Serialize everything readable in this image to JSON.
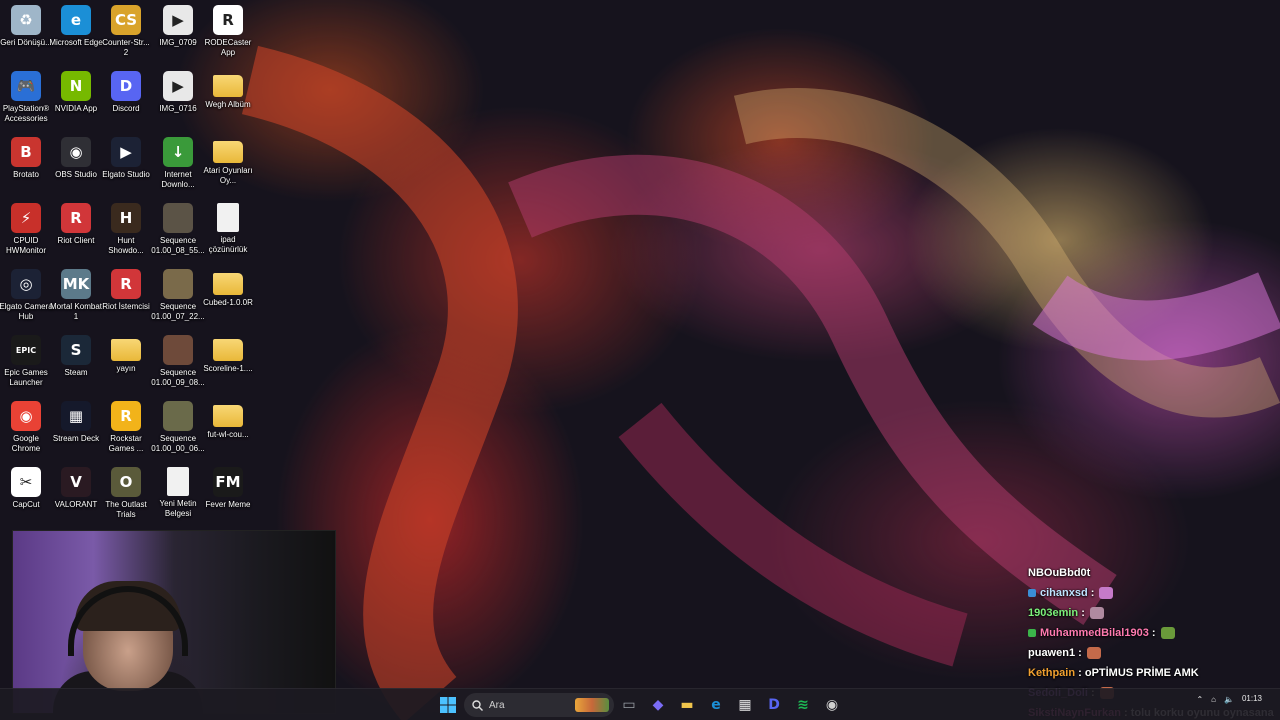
{
  "desktop_icons": [
    {
      "label": "Geri Dönüşü...",
      "icon": "recycle-bin-icon",
      "color": "#9fb6c9",
      "glyph": "♻"
    },
    {
      "label": "Microsoft Edge",
      "icon": "edge-icon",
      "color": "#1b8fd6",
      "glyph": "e"
    },
    {
      "label": "Counter-Str... 2",
      "icon": "counter-strike-icon",
      "color": "#d9a32b",
      "glyph": "CS"
    },
    {
      "label": "IMG_0709",
      "icon": "video-file-icon",
      "color": "#e8e8e8",
      "glyph": "▶"
    },
    {
      "label": "RODECaster App",
      "icon": "rodecaster-icon",
      "color": "#ffffff",
      "glyph": "R"
    },
    {
      "label": "PlayStation® Accessories",
      "icon": "playstation-icon",
      "color": "#2a6fd6",
      "glyph": "🎮"
    },
    {
      "label": "NVIDIA App",
      "icon": "nvidia-icon",
      "color": "#76b900",
      "glyph": "N"
    },
    {
      "label": "Discord",
      "icon": "discord-icon",
      "color": "#5865f2",
      "glyph": "D"
    },
    {
      "label": "IMG_0716",
      "icon": "video-file-icon",
      "color": "#e8e8e8",
      "glyph": "▶"
    },
    {
      "label": "Wegh Albüm",
      "icon": "folder-icon",
      "color": "#f0c44c",
      "glyph": ""
    },
    {
      "label": "Brotato",
      "icon": "brotato-icon",
      "color": "#c9352f",
      "glyph": "B"
    },
    {
      "label": "OBS Studio",
      "icon": "obs-icon",
      "color": "#2f2f35",
      "glyph": "◉"
    },
    {
      "label": "Elgato Studio",
      "icon": "elgato-studio-icon",
      "color": "#1c2235",
      "glyph": "▶"
    },
    {
      "label": "Internet Downlo...",
      "icon": "internet-download-icon",
      "color": "#3a9a3a",
      "glyph": "↓"
    },
    {
      "label": "Atari Oyunları Oy...",
      "icon": "folder-icon",
      "color": "#f0c44c",
      "glyph": ""
    },
    {
      "label": "CPUID HWMonitor",
      "icon": "hwmonitor-icon",
      "color": "#c8302a",
      "glyph": "⚡"
    },
    {
      "label": "Riot Client",
      "icon": "riot-client-icon",
      "color": "#d13639",
      "glyph": "R"
    },
    {
      "label": "Hunt Showdo...",
      "icon": "hunt-showdown-icon",
      "color": "#3a2a1e",
      "glyph": "H"
    },
    {
      "label": "Sequence 01.00_08_55...",
      "icon": "image-thumbnail-icon",
      "color": "#5b5346",
      "glyph": ""
    },
    {
      "label": "ipad çözünürlük",
      "icon": "text-document-icon",
      "color": "#f1f1f1",
      "glyph": ""
    },
    {
      "label": "Elgato Camera Hub",
      "icon": "elgato-camera-hub-icon",
      "color": "#1c2235",
      "glyph": "◎"
    },
    {
      "label": "Mortal Kombat 1",
      "icon": "mortal-kombat-icon",
      "color": "#5c7a8a",
      "glyph": "MK"
    },
    {
      "label": "Riot İstemcisi",
      "icon": "riot-client-icon",
      "color": "#d13639",
      "glyph": "R"
    },
    {
      "label": "Sequence 01.00_07_22...",
      "icon": "image-thumbnail-icon",
      "color": "#7a6a4a",
      "glyph": ""
    },
    {
      "label": "Cubed-1.0.0R",
      "icon": "folder-icon",
      "color": "#f0c44c",
      "glyph": ""
    },
    {
      "label": "Epic Games Launcher",
      "icon": "epic-games-icon",
      "color": "#1a1a1a",
      "glyph": "EPIC"
    },
    {
      "label": "Steam",
      "icon": "steam-icon",
      "color": "#1b2838",
      "glyph": "S"
    },
    {
      "label": "yayın",
      "icon": "folder-icon",
      "color": "#f0c44c",
      "glyph": ""
    },
    {
      "label": "Sequence 01.00_09_08...",
      "icon": "image-thumbnail-icon",
      "color": "#6e4a3a",
      "glyph": ""
    },
    {
      "label": "Scoreline-1....",
      "icon": "folder-icon",
      "color": "#f0c44c",
      "glyph": ""
    },
    {
      "label": "Google Chrome",
      "icon": "chrome-icon",
      "color": "#e94235",
      "glyph": "◉"
    },
    {
      "label": "Stream Deck",
      "icon": "stream-deck-icon",
      "color": "#15192b",
      "glyph": "▦"
    },
    {
      "label": "Rockstar Games ...",
      "icon": "rockstar-icon",
      "color": "#f2b31a",
      "glyph": "R"
    },
    {
      "label": "Sequence 01.00_00_06...",
      "icon": "image-thumbnail-icon",
      "color": "#6a6a4a",
      "glyph": ""
    },
    {
      "label": "fut-wl-cou...",
      "icon": "folder-icon",
      "color": "#f0c44c",
      "glyph": ""
    },
    {
      "label": "CapCut",
      "icon": "capcut-icon",
      "color": "#ffffff",
      "glyph": "✂"
    },
    {
      "label": "VALORANT",
      "icon": "valorant-icon",
      "color": "#2a1a22",
      "glyph": "V"
    },
    {
      "label": "The Outlast Trials",
      "icon": "outlast-trials-icon",
      "color": "#5a5a3a",
      "glyph": "O"
    },
    {
      "label": "Yeni Metin Belgesi",
      "icon": "text-document-icon",
      "color": "#f1f1f1",
      "glyph": ""
    },
    {
      "label": "Fever Meme",
      "icon": "fever-meme-icon",
      "color": "#1a1a1a",
      "glyph": "FM"
    }
  ],
  "chat": [
    {
      "user": "NBOuBbd0t",
      "msg": "",
      "color": "#ffffff",
      "badge": "",
      "emote": ""
    },
    {
      "user": "cihanxsd",
      "msg": "",
      "color": "#bfe4ff",
      "badge": "#3a8fd6",
      "emote": "#c67ac9"
    },
    {
      "user": "1903emin",
      "msg": "",
      "color": "#7cf07a",
      "badge": "",
      "emote": "#b08aa0"
    },
    {
      "user": "MuhammedBilal1903",
      "msg": "",
      "color": "#ff7ab0",
      "badge": "#3bb54a",
      "emote": "#6a9a3a"
    },
    {
      "user": "puawen1",
      "msg": "",
      "color": "#ffffff",
      "badge": "",
      "emote": "#c46a4a"
    },
    {
      "user": "Kethpain",
      "msg": "oPTİMUS PRİME AMK",
      "color": "#f0a030",
      "badge": "",
      "emote": ""
    },
    {
      "user": "Sedoli_Doli",
      "msg": "",
      "color": "#c77dff",
      "badge": "",
      "emote": "#c46a4a"
    },
    {
      "user": "SikstiNaynFurkan",
      "msg": "tolu korku oyunu oynasana",
      "color": "#ff6ec7",
      "badge": "",
      "emote": ""
    }
  ],
  "taskbar": {
    "search_placeholder": "Ara",
    "apps": [
      {
        "icon": "task-view-icon",
        "color": "#9aa0a6",
        "glyph": "▭"
      },
      {
        "icon": "copilot-icon",
        "color": "#7b6cf6",
        "glyph": "◆"
      },
      {
        "icon": "file-explorer-icon",
        "color": "#f0c44c",
        "glyph": "▬"
      },
      {
        "icon": "edge-icon",
        "color": "#1b8fd6",
        "glyph": "e"
      },
      {
        "icon": "microsoft-store-icon",
        "color": "#e8e8e8",
        "glyph": "▦"
      },
      {
        "icon": "discord-icon",
        "color": "#5865f2",
        "glyph": "D"
      },
      {
        "icon": "spotify-icon",
        "color": "#1db954",
        "glyph": "≋"
      },
      {
        "icon": "obs-icon",
        "color": "#cfcfcf",
        "glyph": "◉"
      }
    ],
    "clock_time": "01:13"
  }
}
